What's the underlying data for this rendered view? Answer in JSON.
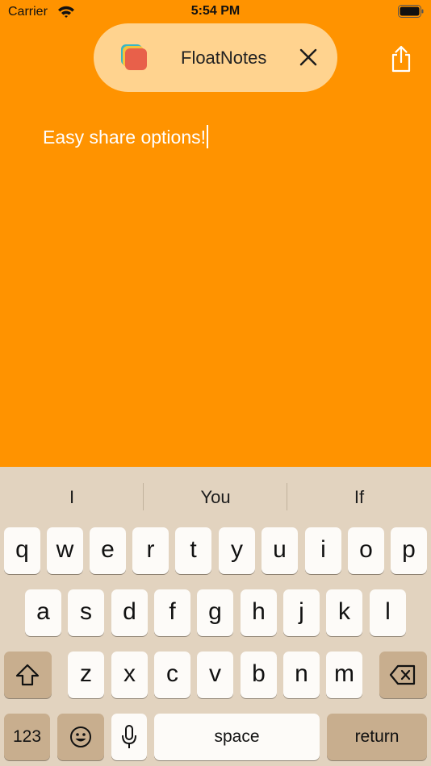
{
  "status_bar": {
    "carrier": "Carrier",
    "time": "5:54 PM",
    "icons": [
      "wifi-icon",
      "battery-icon"
    ]
  },
  "app_pill": {
    "title": "FloatNotes",
    "icons": [
      "app-logo-icon",
      "close-icon"
    ]
  },
  "toolbar": {
    "share_icon": "share-icon"
  },
  "note": {
    "text": "Easy share options!"
  },
  "keyboard": {
    "suggestions": [
      "I",
      "You",
      "If"
    ],
    "rows": [
      [
        "q",
        "w",
        "e",
        "r",
        "t",
        "y",
        "u",
        "i",
        "o",
        "p"
      ],
      [
        "a",
        "s",
        "d",
        "f",
        "g",
        "h",
        "j",
        "k",
        "l"
      ],
      [
        "z",
        "x",
        "c",
        "v",
        "b",
        "n",
        "m"
      ]
    ],
    "numbers_label": "123",
    "space_label": "space",
    "return_label": "return",
    "icons": [
      "shift-icon",
      "delete-icon",
      "emoji-icon",
      "microphone-icon"
    ]
  },
  "colors": {
    "background": "#ff9300",
    "pill": "#ffd38f",
    "keyboard_background": "#e2d3bf",
    "key": "#fdfbf8",
    "function_key": "#c8ae8e"
  }
}
